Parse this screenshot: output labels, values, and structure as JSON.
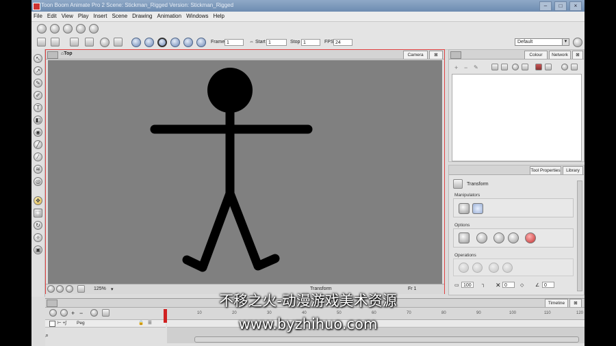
{
  "window": {
    "title": "Toon Boom Animate Pro 2 Scene: Stickman_Rigged Version: Stickman_Rigged"
  },
  "menu": [
    "File",
    "Edit",
    "View",
    "Play",
    "Insert",
    "Scene",
    "Drawing",
    "Animation",
    "Windows",
    "Help"
  ],
  "playback": {
    "frame_label": "Frame",
    "frame_value": "1",
    "start_label": "Start",
    "start_value": "1",
    "stop_label": "Stop",
    "stop_value": "1",
    "fps_label": "FPS",
    "fps_value": "24"
  },
  "workspace": {
    "selected": "Default"
  },
  "viewport": {
    "view_label": "Top",
    "tab": "Camera",
    "zoom": "125%",
    "mode": "Transform",
    "frame": "Fr 1",
    "background_color": "#808080",
    "stickman_color": "#000000"
  },
  "right_top": {
    "tabs": [
      "Colour",
      "Network"
    ]
  },
  "tool_properties": {
    "tabs": [
      "Tool Properties",
      "Library"
    ],
    "tool_name": "Transform",
    "groups": [
      "Manipulators",
      "Options",
      "Operations"
    ],
    "field1": "100",
    "field2": "0",
    "field3": "0"
  },
  "timeline": {
    "tab": "Timeline",
    "layer_name": "Peg",
    "ruler_numbers": [
      "10",
      "20",
      "30",
      "40",
      "50",
      "60",
      "70",
      "80",
      "90",
      "100",
      "110",
      "120"
    ]
  },
  "watermark": {
    "line1": "不移之火-动漫游戏美术资源",
    "line2": "www.byzhihuo.com"
  }
}
